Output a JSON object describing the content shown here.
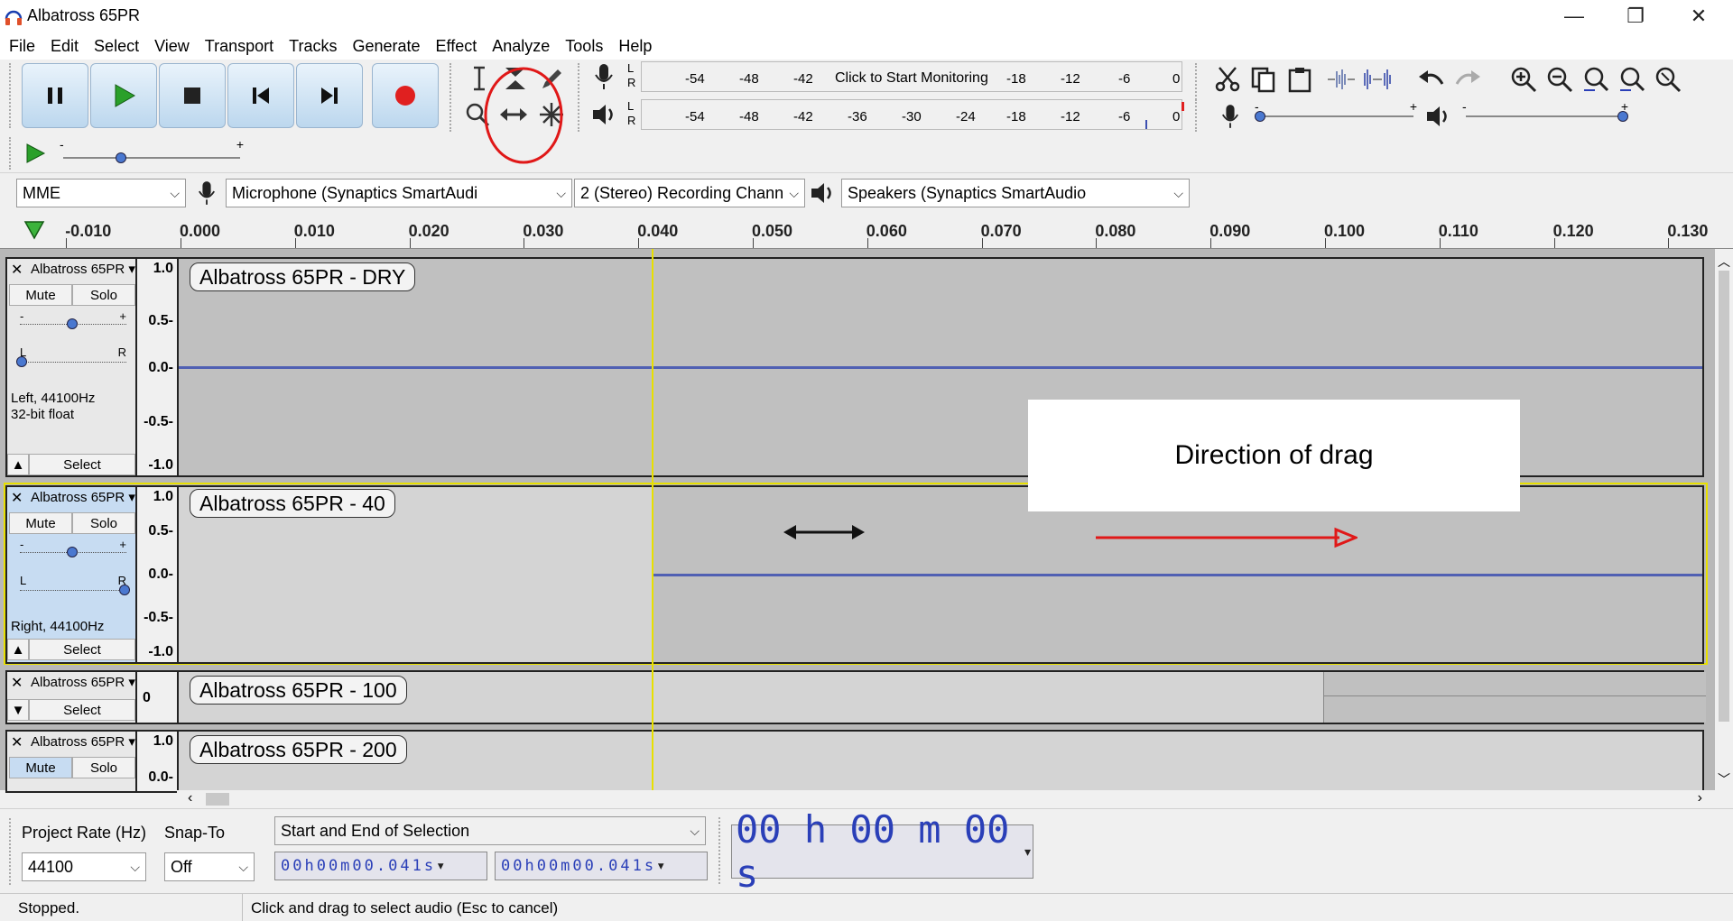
{
  "window": {
    "title": "Albatross 65PR",
    "minimize_glyph": "—",
    "restore_glyph": "❐",
    "close_glyph": "✕"
  },
  "menu": [
    "File",
    "Edit",
    "Select",
    "View",
    "Transport",
    "Tracks",
    "Generate",
    "Effect",
    "Analyze",
    "Tools",
    "Help"
  ],
  "meters": {
    "record_ticks": [
      "-54",
      "-48",
      "-42",
      "Click to Start Monitoring",
      "-18",
      "-12",
      "-6",
      "0"
    ],
    "playback_ticks": [
      "-54",
      "-48",
      "-42",
      "-36",
      "-30",
      "-24",
      "-18",
      "-12",
      "-6",
      "0"
    ],
    "lr": [
      "L",
      "R"
    ]
  },
  "sliders": {
    "minus": "-",
    "plus": "+"
  },
  "device": {
    "host": "MME",
    "input": "Microphone (Synaptics SmartAudi",
    "channels": "2 (Stereo) Recording Chann",
    "output": "Speakers (Synaptics SmartAudio"
  },
  "ruler": {
    "labels": [
      "-0.010",
      "0.000",
      "0.010",
      "0.020",
      "0.030",
      "0.040",
      "0.050",
      "0.060",
      "0.070",
      "0.080",
      "0.090",
      "0.100",
      "0.110",
      "0.120",
      "0.130"
    ]
  },
  "tracks": [
    {
      "name": "Albatross 65PR",
      "clip": "Albatross 65PR - DRY",
      "mute": "Mute",
      "solo": "Solo",
      "pan_l": "L",
      "pan_r": "R",
      "info1": "Left, 44100Hz",
      "info2": "32-bit float",
      "select": "Select",
      "scale": [
        "1.0",
        "0.5-",
        "0.0-",
        "-0.5-",
        "-1.0"
      ]
    },
    {
      "name": "Albatross 65PR",
      "clip": "Albatross 65PR - 40",
      "mute": "Mute",
      "solo": "Solo",
      "pan_l": "L",
      "pan_r": "R",
      "info1": "Right, 44100Hz",
      "select": "Select",
      "scale": [
        "1.0",
        "0.5-",
        "0.0-",
        "-0.5-",
        "-1.0"
      ]
    },
    {
      "name": "Albatross 65PR",
      "clip": "Albatross 65PR - 100",
      "select": "Select",
      "scale": [
        "0"
      ]
    },
    {
      "name": "Albatross 65PR",
      "clip": "Albatross 65PR - 200",
      "mute": "Mute",
      "solo": "Solo",
      "scale": [
        "1.0",
        "0.0-"
      ]
    }
  ],
  "annotation": {
    "drag_text": "Direction of drag"
  },
  "selection_toolbar": {
    "rate_label": "Project Rate (Hz)",
    "snap_label": "Snap-To",
    "rate_value": "44100",
    "snap_value": "Off",
    "mode": "Start and End of Selection",
    "start": "00h00m00.041s",
    "end": "00h00m00.041s",
    "big_time": "00 h 00 m 00 s"
  },
  "status": {
    "left": "Stopped.",
    "right": "Click and drag to select audio (Esc to cancel)"
  },
  "colors": {
    "waveform": "#3c4fb0",
    "cursor": "#e8e000",
    "record": "#e02020",
    "play": "#2aa02a",
    "annotation_red": "#e01818"
  }
}
